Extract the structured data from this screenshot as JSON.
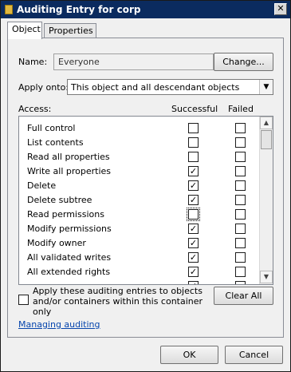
{
  "window": {
    "title": "Auditing Entry for corp",
    "close_glyph": "✕"
  },
  "tabs": [
    {
      "label": "Object",
      "active": true
    },
    {
      "label": "Properties",
      "active": false
    }
  ],
  "name": {
    "label": "Name:",
    "value": "Everyone",
    "change_button": "Change..."
  },
  "apply_onto": {
    "label": "Apply onto:",
    "value": "This object and all descendant objects",
    "arrow_glyph": "▼"
  },
  "access": {
    "header": "Access:",
    "col_successful": "Successful",
    "col_failed": "Failed",
    "rows": [
      {
        "label": "Full control",
        "successful": false,
        "failed": false
      },
      {
        "label": "List contents",
        "successful": false,
        "failed": false
      },
      {
        "label": "Read all properties",
        "successful": false,
        "failed": false
      },
      {
        "label": "Write all properties",
        "successful": true,
        "failed": false
      },
      {
        "label": "Delete",
        "successful": true,
        "failed": false
      },
      {
        "label": "Delete subtree",
        "successful": true,
        "failed": false
      },
      {
        "label": "Read permissions",
        "successful": false,
        "failed": false,
        "focused": true
      },
      {
        "label": "Modify permissions",
        "successful": true,
        "failed": false
      },
      {
        "label": "Modify owner",
        "successful": true,
        "failed": false
      },
      {
        "label": "All validated writes",
        "successful": true,
        "failed": false
      },
      {
        "label": "All extended rights",
        "successful": true,
        "failed": false
      },
      {
        "label": "",
        "successful": true,
        "failed": false
      }
    ],
    "check_glyph": "✓",
    "scroll_up_glyph": "▲",
    "scroll_down_glyph": "▼"
  },
  "apply_checkbox": {
    "label": "Apply these auditing entries to objects and/or containers within this container only",
    "checked": false
  },
  "clear_all_button": "Clear All",
  "help_link": "Managing auditing",
  "footer": {
    "ok_button": "OK",
    "cancel_button": "Cancel"
  }
}
